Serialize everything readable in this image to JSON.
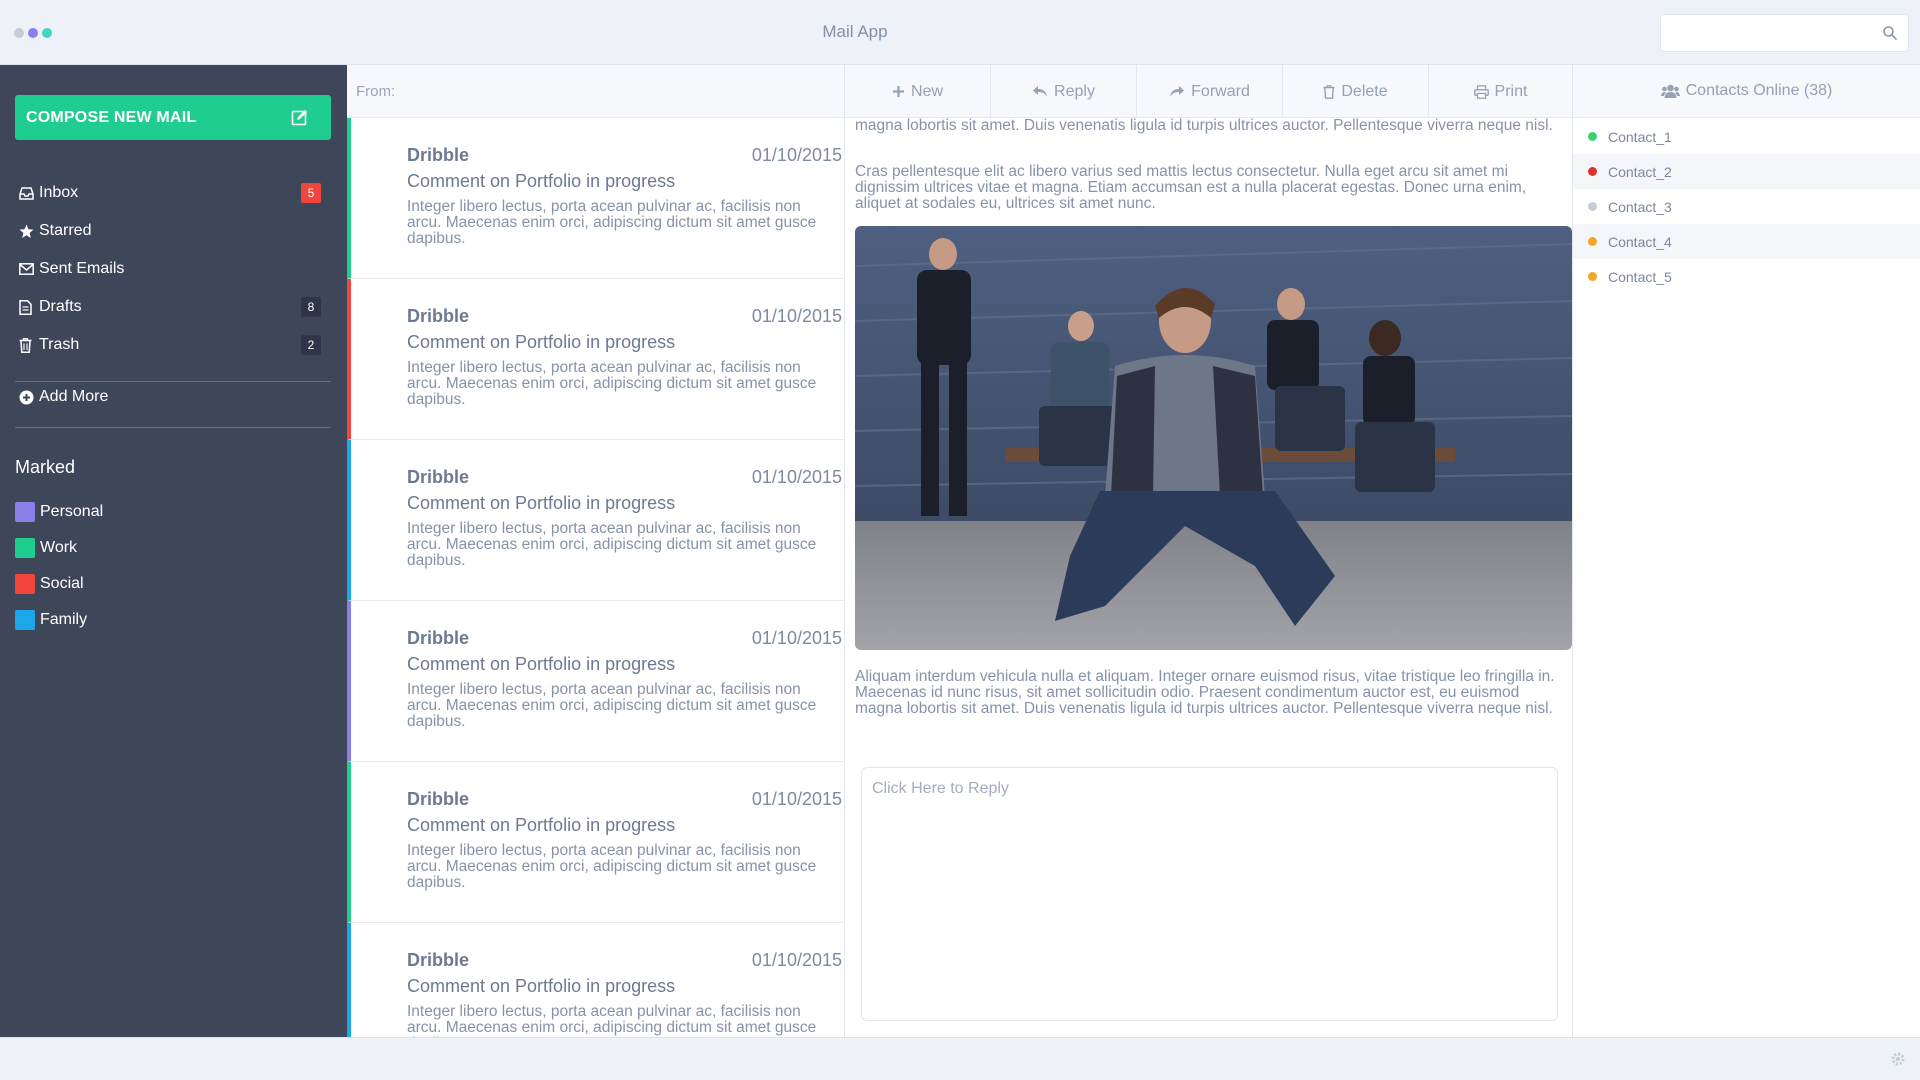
{
  "window": {
    "title": "Mail App",
    "dot_colors": [
      "#c7cbd4",
      "#8b7ff0",
      "#44d4c3"
    ]
  },
  "search": {
    "placeholder": "",
    "icon": "search-icon"
  },
  "sidebar": {
    "compose_label": "COMPOSE NEW MAIL",
    "items": [
      {
        "label": "Inbox",
        "icon": "inbox-icon",
        "badge": "5",
        "badge_color": "#f1453d"
      },
      {
        "label": "Starred",
        "icon": "star-icon",
        "badge": ""
      },
      {
        "label": "Sent Emails",
        "icon": "envelope-icon",
        "badge": ""
      },
      {
        "label": "Drafts",
        "icon": "file-icon",
        "badge": "8",
        "badge_color": "#2e3546"
      },
      {
        "label": "Trash",
        "icon": "trash-icon",
        "badge": "2",
        "badge_color": "#2e3546"
      }
    ],
    "add_more_label": "Add More",
    "marked_title": "Marked",
    "labels": [
      {
        "label": "Personal",
        "color": "#8a7fe8"
      },
      {
        "label": "Work",
        "color": "#1fce8e"
      },
      {
        "label": "Social",
        "color": "#f1453d"
      },
      {
        "label": "Family",
        "color": "#1ea7e8"
      }
    ]
  },
  "list": {
    "from_label": "From:",
    "messages": [
      {
        "sender": "Dribble",
        "date": "01/10/2015",
        "subject": "Comment on Portfolio in progress",
        "preview": "Integer libero lectus, porta acean pulvinar ac, facilisis non arcu. Maecenas enim orci, adipiscing dictum sit amet gusce dapibus.",
        "accent": "#1fce8e"
      },
      {
        "sender": "Dribble",
        "date": "01/10/2015",
        "subject": "Comment on Portfolio in progress",
        "preview": "Integer libero lectus, porta acean pulvinar ac, facilisis non arcu. Maecenas enim orci, adipiscing dictum sit amet gusce dapibus.",
        "accent": "#f1453d"
      },
      {
        "sender": "Dribble",
        "date": "01/10/2015",
        "subject": "Comment on Portfolio in progress",
        "preview": "Integer libero lectus, porta acean pulvinar ac, facilisis non arcu. Maecenas enim orci, adipiscing dictum sit amet gusce dapibus.",
        "accent": "#1ea7e8"
      },
      {
        "sender": "Dribble",
        "date": "01/10/2015",
        "subject": "Comment on Portfolio in progress",
        "preview": "Integer libero lectus, porta acean pulvinar ac, facilisis non arcu. Maecenas enim orci, adipiscing dictum sit amet gusce dapibus.",
        "accent": "#8a7fe8"
      },
      {
        "sender": "Dribble",
        "date": "01/10/2015",
        "subject": "Comment on Portfolio in progress",
        "preview": "Integer libero lectus, porta acean pulvinar ac, facilisis non arcu. Maecenas enim orci, adipiscing dictum sit amet gusce dapibus.",
        "accent": "#1fce8e"
      },
      {
        "sender": "Dribble",
        "date": "01/10/2015",
        "subject": "Comment on Portfolio in progress",
        "preview": "Integer libero lectus, porta acean pulvinar ac, facilisis non arcu. Maecenas enim orci, adipiscing dictum sit amet gusce dapibus.",
        "accent": "#1ea7e8"
      }
    ]
  },
  "toolbar": {
    "new_label": "New",
    "reply_label": "Reply",
    "forward_label": "Forward",
    "delete_label": "Delete",
    "print_label": "Print"
  },
  "reading": {
    "para_top": "magna lobortis sit amet. Duis venenatis ligula id turpis ultrices auctor. Pellentesque viverra neque nisl.",
    "para_2": "Cras pellentesque elit ac libero varius sed mattis lectus consectetur. Nulla eget arcu sit amet mi dignissim ultrices vitae et magna. Etiam accumsan est a nulla placerat egestas. Donec urna enim, aliquet at sodales eu, ultrices sit amet nunc.",
    "para_3": "Aliquam interdum vehicula nulla et aliquam. Integer ornare euismod risus, vitae tristique leo fringilla in. Maecenas id nunc risus, sit amet sollicitudin odio. Praesent condimentum auctor est, eu euismod magna lobortis sit amet. Duis venenatis ligula id turpis ultrices auctor. Pellentesque viverra neque nisl.",
    "reply_placeholder": "Click Here to Reply"
  },
  "contacts": {
    "header_label": "Contacts Online (38)",
    "items": [
      {
        "name": "Contact_1",
        "status_color": "#3fcf6e"
      },
      {
        "name": "Contact_2",
        "status_color": "#e0302a"
      },
      {
        "name": "Contact_3",
        "status_color": "#c6cdd9"
      },
      {
        "name": "Contact_4",
        "status_color": "#f5a623"
      },
      {
        "name": "Contact_5",
        "status_color": "#f5a623"
      }
    ]
  }
}
